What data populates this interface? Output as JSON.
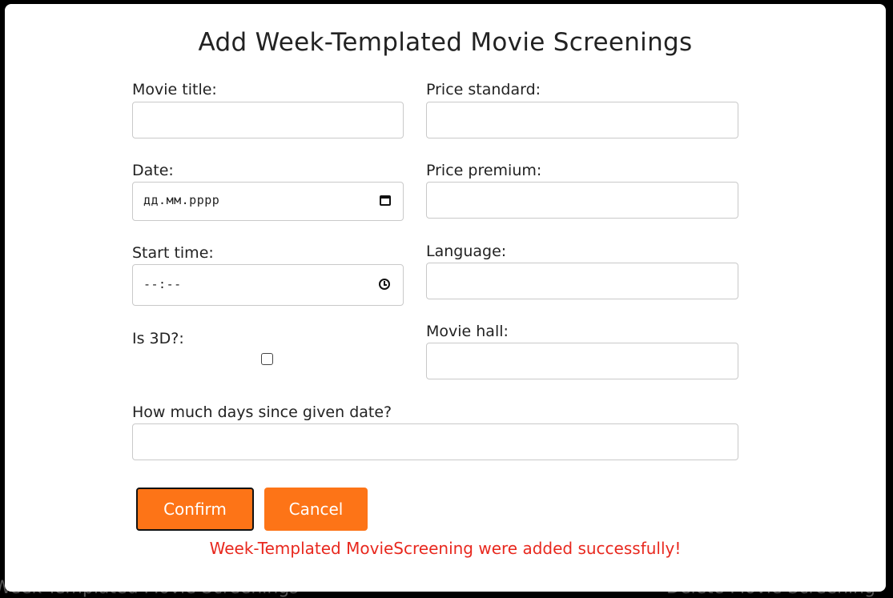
{
  "background": {
    "left_text": "Week-Templated Movie Screenings",
    "right_text": "Delete Movie Screening"
  },
  "modal": {
    "title": "Add Week-Templated Movie Screenings",
    "fields": {
      "movie_title": {
        "label": "Movie title:",
        "value": ""
      },
      "price_standard": {
        "label": "Price standard:",
        "value": ""
      },
      "date": {
        "label": "Date:",
        "placeholder": "дд.мм.рррр"
      },
      "price_premium": {
        "label": "Price premium:",
        "value": ""
      },
      "start_time": {
        "label": "Start time:",
        "placeholder": "--:--"
      },
      "language": {
        "label": "Language:",
        "value": ""
      },
      "is_3d": {
        "label": "Is 3D?:",
        "checked": false
      },
      "movie_hall": {
        "label": "Movie hall:",
        "value": ""
      },
      "days_since": {
        "label": "How much days since given date?",
        "value": ""
      }
    },
    "buttons": {
      "confirm": "Confirm",
      "cancel": "Cancel"
    },
    "status_message": "Week-Templated MovieScreening were added successfully!",
    "colors": {
      "accent": "#fd7417",
      "status": "#e8281e"
    }
  }
}
